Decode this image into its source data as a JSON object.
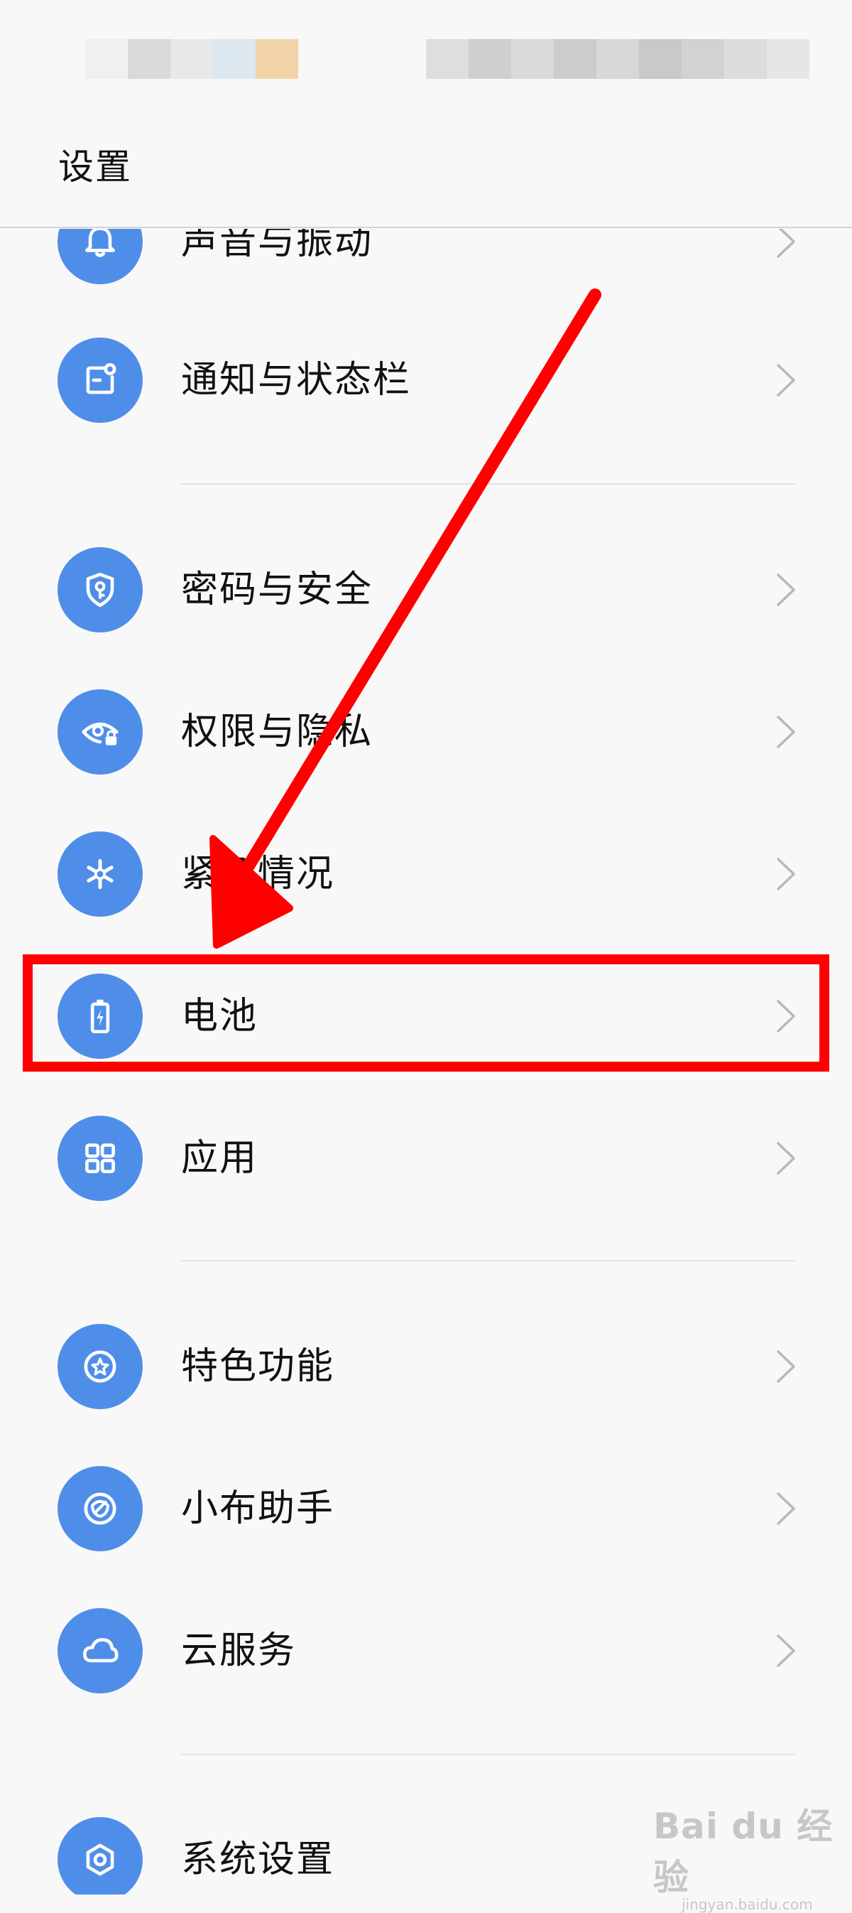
{
  "header": {
    "title": "设置"
  },
  "settings_items": [
    {
      "id": "sound",
      "label": "声音与振动",
      "icon": "bell-icon"
    },
    {
      "id": "notification",
      "label": "通知与状态栏",
      "icon": "notification-icon"
    },
    {
      "id": "password",
      "label": "密码与安全",
      "icon": "shield-key-icon"
    },
    {
      "id": "privacy",
      "label": "权限与隐私",
      "icon": "eye-lock-icon"
    },
    {
      "id": "emergency",
      "label": "紧急情况",
      "icon": "asterisk-icon"
    },
    {
      "id": "battery",
      "label": "电池",
      "icon": "battery-icon"
    },
    {
      "id": "apps",
      "label": "应用",
      "icon": "grid-icon"
    },
    {
      "id": "features",
      "label": "特色功能",
      "icon": "star-icon"
    },
    {
      "id": "assistant",
      "label": "小布助手",
      "icon": "assistant-icon"
    },
    {
      "id": "cloud",
      "label": "云服务",
      "icon": "cloud-icon"
    },
    {
      "id": "system",
      "label": "系统设置",
      "icon": "gear-icon"
    }
  ],
  "annotation": {
    "highlighted_item": "电池",
    "color": "#ff0000"
  },
  "watermark": {
    "logo": "Bai du 经验",
    "url": "jingyan.baidu.com"
  },
  "colors": {
    "accent": "#4f8ee8",
    "background": "#f8f8f8",
    "annotation": "#ff0000"
  }
}
